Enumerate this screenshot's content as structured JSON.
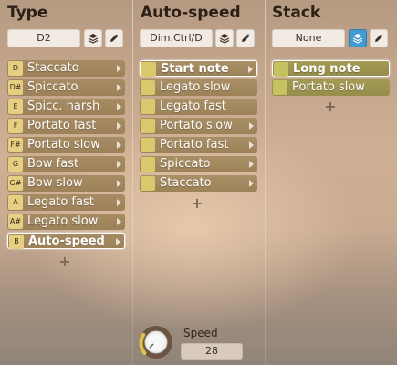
{
  "type_panel": {
    "title": "Type",
    "selector_value": "D2",
    "items": [
      {
        "key": "D",
        "label": "Staccato"
      },
      {
        "key": "D#",
        "label": "Spiccato"
      },
      {
        "key": "E",
        "label": "Spicc. harsh"
      },
      {
        "key": "F",
        "label": "Portato fast"
      },
      {
        "key": "F#",
        "label": "Portato slow"
      },
      {
        "key": "G",
        "label": "Bow fast"
      },
      {
        "key": "G#",
        "label": "Bow slow"
      },
      {
        "key": "A",
        "label": "Legato fast"
      },
      {
        "key": "A#",
        "label": "Legato slow"
      },
      {
        "key": "B",
        "label": "Auto-speed"
      }
    ],
    "selected_index": 9,
    "add_label": "+"
  },
  "auto_speed_panel": {
    "title": "Auto-speed",
    "selector_value": "Dim.Ctrl/D",
    "items": [
      {
        "label": "Start note"
      },
      {
        "label": "Legato slow"
      },
      {
        "label": "Legato fast"
      },
      {
        "label": "Portato slow"
      },
      {
        "label": "Portato fast"
      },
      {
        "label": "Spiccato"
      },
      {
        "label": "Staccato"
      }
    ],
    "selected_index": 0,
    "add_label": "+"
  },
  "stack_panel": {
    "title": "Stack",
    "selector_value": "None",
    "items": [
      {
        "label": "Long note"
      },
      {
        "label": "Portato slow"
      }
    ],
    "selected_index": 0,
    "add_label": "+"
  },
  "speed_control": {
    "label": "Speed",
    "value": "28"
  },
  "colors": {
    "row_bg": "#a08459",
    "key_badge": "#e4cf82",
    "swatch": "#d9c86c",
    "stack_active_icon": "#3f9bd1",
    "selected_border": "#ffffff"
  }
}
